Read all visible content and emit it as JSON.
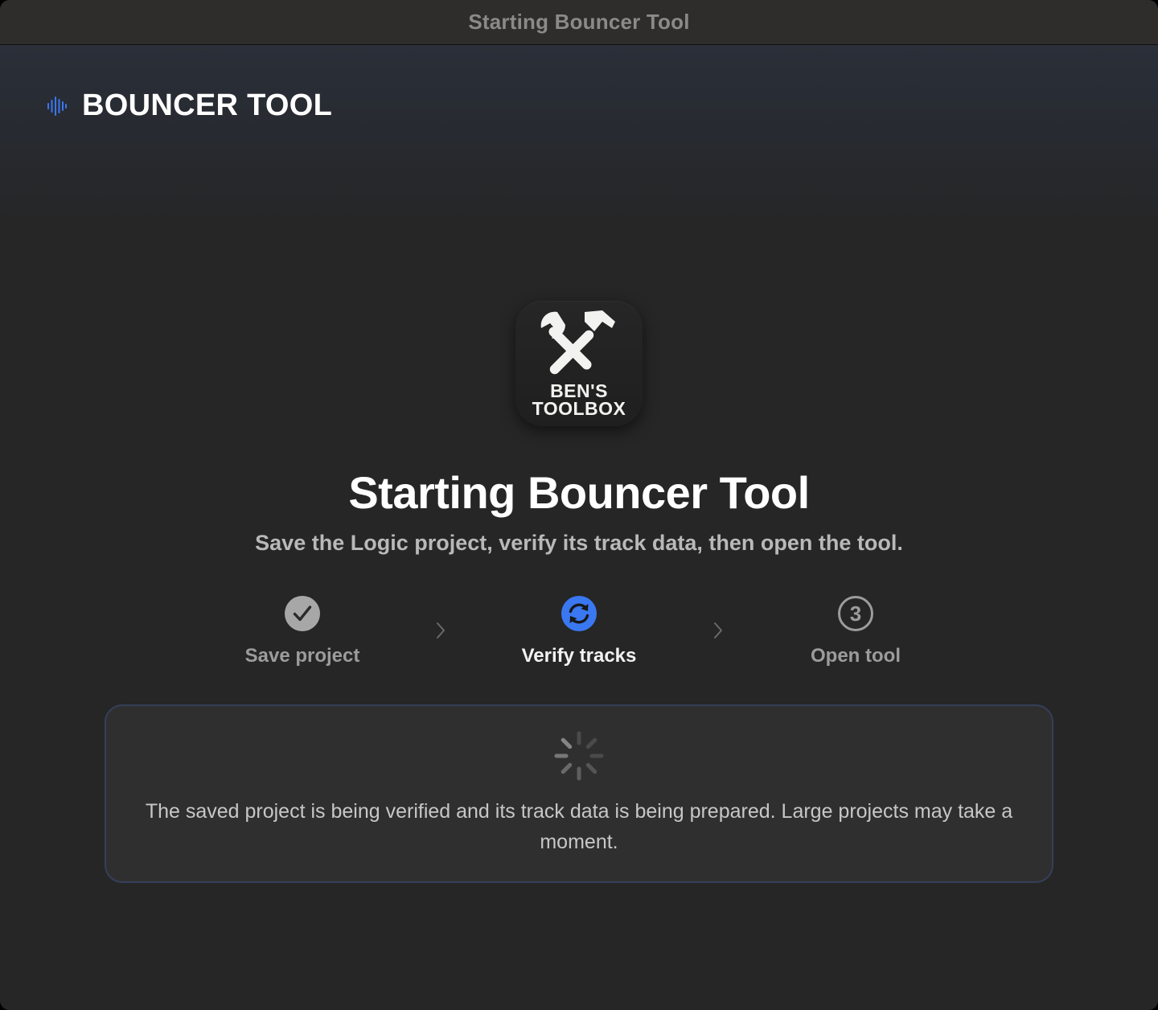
{
  "window": {
    "title": "Starting Bouncer Tool"
  },
  "brand": {
    "name": "BOUNCER TOOL",
    "icon": "waveform-icon",
    "accent_color": "#3a78f2"
  },
  "app_icon": {
    "line1": "BEN'S",
    "line2": "TOOLBOX",
    "icon": "wrench-hammer-icon"
  },
  "header": {
    "title": "Starting Bouncer Tool",
    "subtitle": "Save the Logic project, verify its track data, then open the tool."
  },
  "steps": [
    {
      "label": "Save project",
      "state": "complete",
      "icon": "checkmark-circle-icon"
    },
    {
      "label": "Verify tracks",
      "state": "in-progress",
      "icon": "sync-circle-icon",
      "color": "#3a78f2"
    },
    {
      "label": "Open tool",
      "state": "pending",
      "icon": "number-3-circle-icon",
      "number": "3"
    }
  ],
  "status": {
    "message": "The saved project is being verified and its track data is being prepared. Large projects may take a moment.",
    "icon": "spinner-icon"
  }
}
